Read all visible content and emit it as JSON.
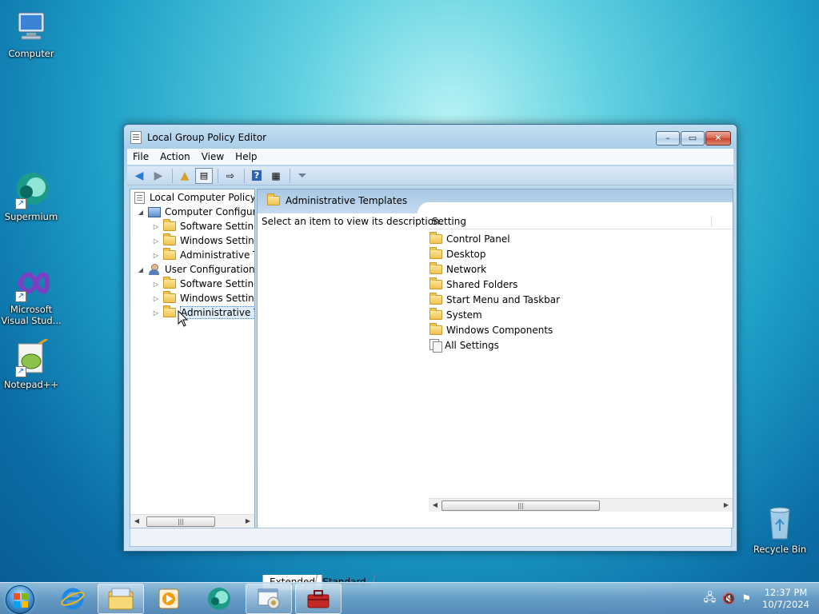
{
  "desktop": {
    "icons": [
      {
        "label": "Computer"
      },
      {
        "label": "Supermium"
      },
      {
        "label": "Microsoft Visual Stud..."
      },
      {
        "label": "Notepad++"
      },
      {
        "label": "Recycle Bin"
      }
    ]
  },
  "window": {
    "title": "Local Group Policy Editor",
    "menu": [
      "File",
      "Action",
      "View",
      "Help"
    ],
    "tree": {
      "root": "Local Computer Policy",
      "computer_config": "Computer Configura",
      "cc_software": "Software Settings",
      "cc_windows": "Windows Setting",
      "cc_admin": "Administrative Te",
      "user_config": "User Configuration",
      "uc_software": "Software Settings",
      "uc_windows": "Windows Setting",
      "uc_admin": "Administrative Te"
    },
    "right_pane": {
      "header_title": "Administrative Templates",
      "description": "Select an item to view its description.",
      "column_header": "Setting",
      "items": [
        {
          "label": "Control Panel",
          "icon": "folder-icon"
        },
        {
          "label": "Desktop",
          "icon": "folder-icon"
        },
        {
          "label": "Network",
          "icon": "folder-icon"
        },
        {
          "label": "Shared Folders",
          "icon": "folder-icon"
        },
        {
          "label": "Start Menu and Taskbar",
          "icon": "folder-icon"
        },
        {
          "label": "System",
          "icon": "folder-icon"
        },
        {
          "label": "Windows Components",
          "icon": "folder-icon"
        },
        {
          "label": "All Settings",
          "icon": "all-settings-icon"
        }
      ]
    },
    "tabs": [
      "Extended",
      "Standard"
    ]
  },
  "taskbar": {
    "time": "12:37 PM",
    "date": "10/7/2024"
  }
}
